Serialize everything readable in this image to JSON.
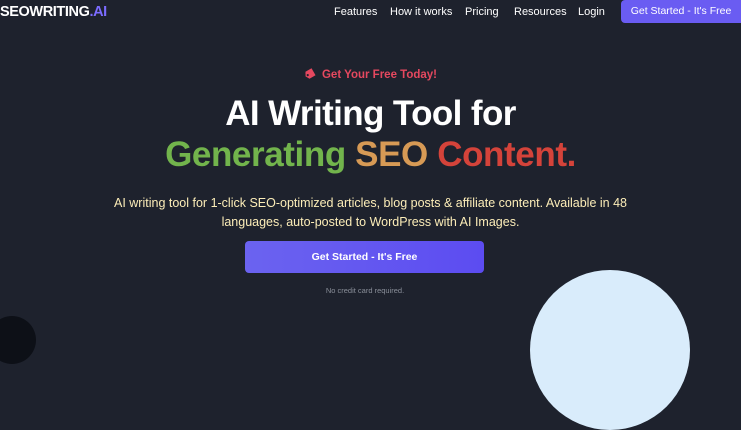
{
  "nav": {
    "logo_main": "SEOWRITING",
    "logo_accent": ".AI",
    "links": [
      "Features",
      "How it works",
      "Pricing",
      "Resources",
      "Login"
    ],
    "cta_label": "Get Started - It's Free"
  },
  "hero": {
    "badge": "Get Your Free Today!",
    "headline_line1": "AI Writing Tool for",
    "headline_line2_words": [
      "Generating",
      "SEO",
      "Content."
    ],
    "subtitle": "AI writing tool for 1-click SEO-optimized articles, blog posts & affiliate content. Available in 48 languages, auto-posted to WordPress with AI Images.",
    "cta_label": "Get Started - It's Free",
    "note": "No credit card required."
  },
  "colors": {
    "background": "#1e222d",
    "accent": "#6a5cf2",
    "badge": "#e5485f",
    "headline_word1": "#72b44c",
    "headline_word2": "#d79a55",
    "headline_word3": "#d4433a",
    "subtitle": "#fcedb8"
  },
  "icons": {
    "badge_icon": "price-tag-icon"
  }
}
